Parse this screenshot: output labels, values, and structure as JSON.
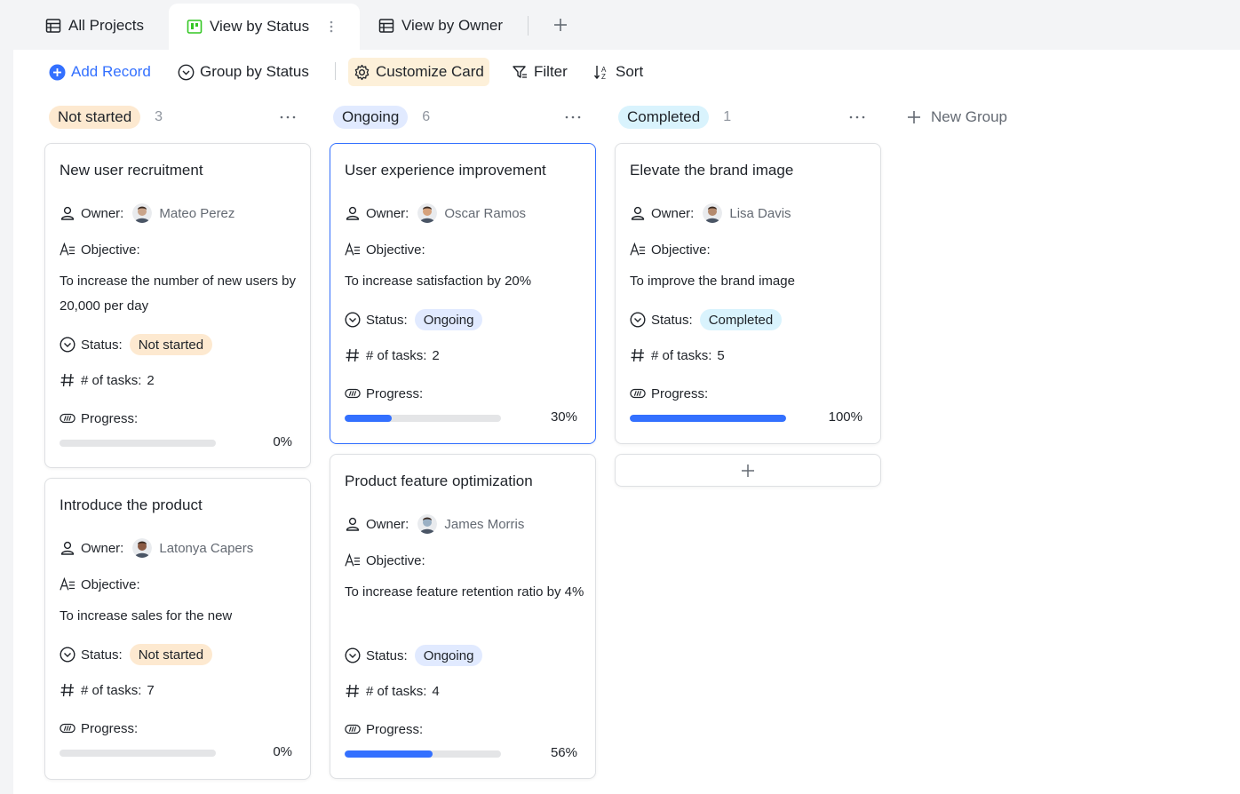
{
  "tabs": [
    {
      "label": "All Projects",
      "icon": "table-icon"
    },
    {
      "label": "View by Status",
      "icon": "kanban-icon"
    },
    {
      "label": "View by Owner",
      "icon": "table-icon"
    }
  ],
  "toolbar": {
    "add_record": "Add Record",
    "group_by": "Group by Status",
    "customize_card": "Customize Card",
    "filter": "Filter",
    "sort": "Sort"
  },
  "groups": [
    {
      "label": "Not started",
      "count": "3"
    },
    {
      "label": "Ongoing",
      "count": "6"
    },
    {
      "label": "Completed",
      "count": "1"
    }
  ],
  "new_group_label": "New Group",
  "field_labels": {
    "owner": "Owner:",
    "objective": "Objective:",
    "status": "Status:",
    "tasks_prefix": "# of tasks:",
    "progress": "Progress:"
  },
  "cards": [
    {
      "title": "New user recruitment",
      "owner": "Mateo Perez",
      "objective": "To increase the number of new users by 20,000 per day",
      "status": "Not started",
      "tasks": "2",
      "progress": 0,
      "progress_label": "0%"
    },
    {
      "title": "Introduce the product",
      "owner": "Latonya Capers",
      "objective": "To increase sales for the new",
      "status": "Not started",
      "tasks": "7",
      "progress": 0,
      "progress_label": "0%"
    },
    {
      "title": "User experience improvement",
      "owner": "Oscar Ramos",
      "objective": "To increase satisfaction by 20%",
      "status": "Ongoing",
      "tasks": "2",
      "progress": 30,
      "progress_label": "30%"
    },
    {
      "title": "Product feature optimization",
      "owner": "James Morris",
      "objective": "To increase feature retention ratio by 4%",
      "status": "Ongoing",
      "tasks": "4",
      "progress": 56,
      "progress_label": "56%"
    },
    {
      "title": "Elevate the brand image",
      "owner": "Lisa Davis",
      "objective": "To improve the brand image",
      "status": "Completed",
      "tasks": "5",
      "progress": 100,
      "progress_label": "100%"
    }
  ],
  "colors": {
    "accent": "#3370ff",
    "not_started": "#fde9d0",
    "ongoing": "#e1eaff",
    "completed": "#d9f3fd"
  }
}
